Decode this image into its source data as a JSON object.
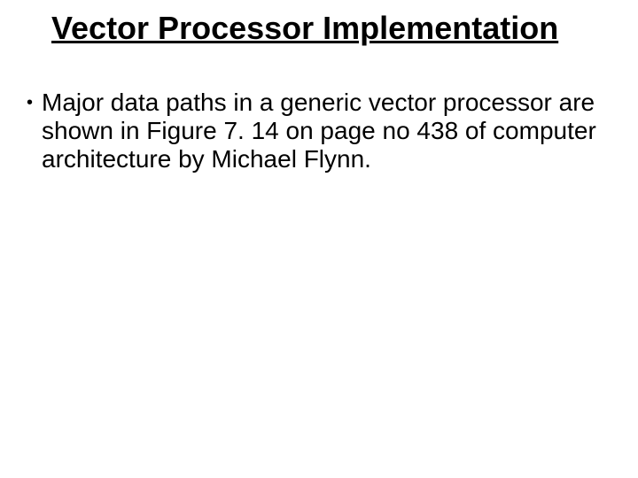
{
  "title": "Vector Processor Implementation",
  "bullets": [
    {
      "text": "Major data paths in a generic vector processor are shown in Figure 7. 14 on page no 438 of computer architecture by Michael Flynn."
    }
  ]
}
